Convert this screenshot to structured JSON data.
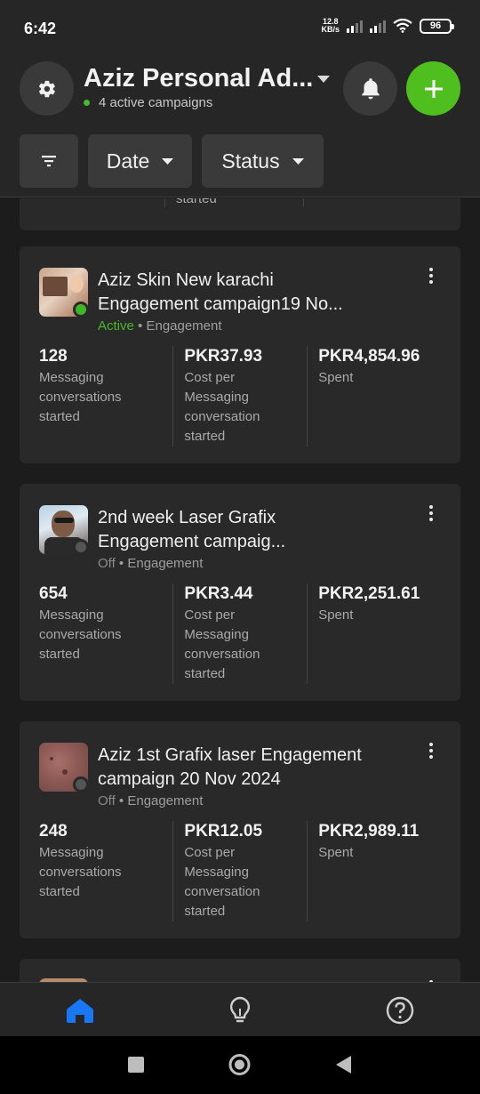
{
  "status_bar": {
    "time": "6:42",
    "net_speed_value": "12.8",
    "net_speed_unit": "KB/s",
    "battery": "96"
  },
  "header": {
    "account_name": "Aziz Personal Ad...",
    "subtitle": "4 active campaigns",
    "icons": [
      "gear-icon",
      "bell-icon",
      "plus-icon"
    ],
    "accent_color": "#4fbf1f"
  },
  "filters": {
    "date_label": "Date",
    "status_label": "Status"
  },
  "partial_top_card": {
    "fragment": "started"
  },
  "campaigns": [
    {
      "title_line1": "Aziz Skin New karachi",
      "title_line2": "Engagement campaign19 No...",
      "state": "Active",
      "objective": "Engagement",
      "metric1_value": "128",
      "metric1_label": "Messaging conversations started",
      "metric2_value": "PKR37.93",
      "metric2_label": "Cost per Messaging conversation started",
      "metric3_value": "PKR4,854.96",
      "metric3_label": "Spent"
    },
    {
      "title_line1": "2nd week Laser Grafix",
      "title_line2": "Engagement campaig...",
      "state": "Off",
      "objective": "Engagement",
      "metric1_value": "654",
      "metric1_label": "Messaging conversations started",
      "metric2_value": "PKR3.44",
      "metric2_label": "Cost per Messaging conversation started",
      "metric3_value": "PKR2,251.61",
      "metric3_label": "Spent"
    },
    {
      "title_line1": "Aziz 1st Grafix laser Engagement",
      "title_line2": "campaign 20 Nov 2024",
      "state": "Off",
      "objective": "Engagement",
      "metric1_value": "248",
      "metric1_label": "Messaging conversations started",
      "metric2_value": "PKR12.05",
      "metric2_label": "Cost per Messaging conversation started",
      "metric3_value": "PKR2,989.11",
      "metric3_label": "Spent"
    }
  ],
  "separator": "•",
  "bottom_nav": [
    "home-icon",
    "lightbulb-icon",
    "help-icon"
  ],
  "system_nav": [
    "recents-button",
    "home-button",
    "back-button"
  ]
}
